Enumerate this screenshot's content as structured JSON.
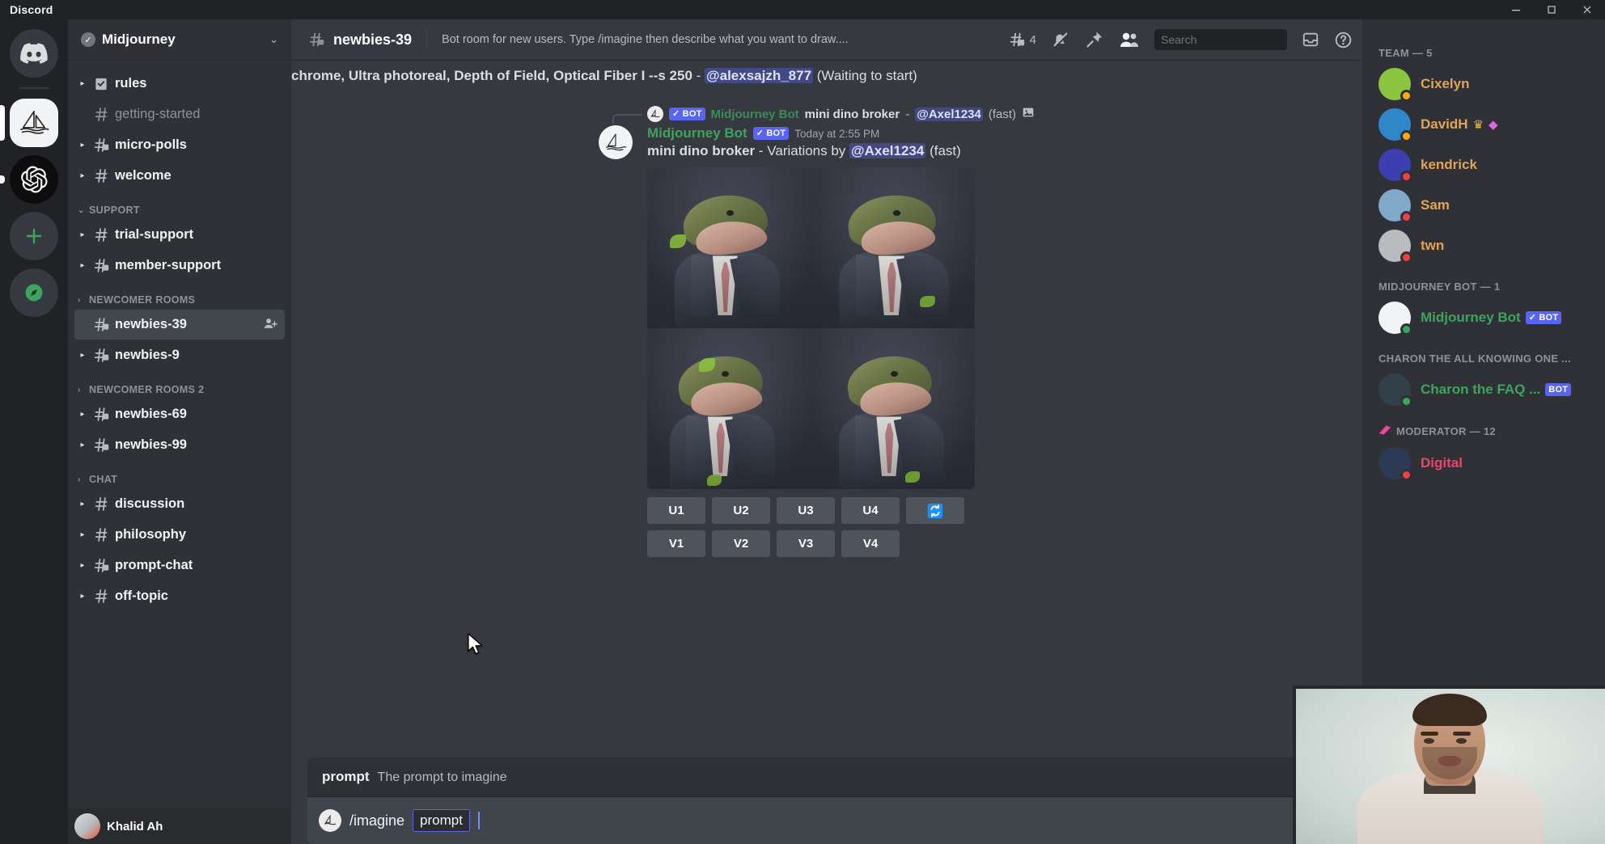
{
  "titlebar": {
    "brand": "Discord",
    "minimize": "—",
    "maximize": "▣",
    "close": "✕"
  },
  "rail": {
    "items": [
      {
        "name": "home",
        "icon": "discord-logo"
      },
      {
        "name": "midjourney",
        "icon": "sailboat"
      },
      {
        "name": "openai",
        "icon": "openai-flower"
      },
      {
        "name": "add-server",
        "icon": "plus"
      },
      {
        "name": "explore",
        "icon": "compass"
      }
    ]
  },
  "sidebar": {
    "server": {
      "name": "Midjourney",
      "verified": "✓",
      "chevron": "⌄"
    },
    "groups": [
      {
        "label": "",
        "arrow": "",
        "channels": [
          {
            "name": "rules",
            "icon": "rules",
            "arrow": "▸",
            "bright": true
          },
          {
            "name": "getting-started",
            "icon": "hash",
            "arrow": "",
            "bright": false
          },
          {
            "name": "micro-polls",
            "icon": "forum",
            "arrow": "▸",
            "bright": true
          },
          {
            "name": "welcome",
            "icon": "hash",
            "arrow": "▸",
            "bright": true
          }
        ]
      },
      {
        "label": "SUPPORT",
        "arrow": "⌄",
        "channels": [
          {
            "name": "trial-support",
            "icon": "hash",
            "arrow": "▸",
            "bright": true
          },
          {
            "name": "member-support",
            "icon": "forum",
            "arrow": "▸",
            "bright": true
          }
        ]
      },
      {
        "label": "NEWCOMER ROOMS",
        "arrow": "›",
        "channels": [
          {
            "name": "newbies-39",
            "icon": "forum",
            "arrow": "",
            "bright": true,
            "selected": true,
            "invite": "person-add"
          },
          {
            "name": "newbies-9",
            "icon": "forum",
            "arrow": "▸",
            "bright": true
          }
        ]
      },
      {
        "label": "NEWCOMER ROOMS 2",
        "arrow": "›",
        "channels": [
          {
            "name": "newbies-69",
            "icon": "forum",
            "arrow": "▸",
            "bright": true
          },
          {
            "name": "newbies-99",
            "icon": "forum",
            "arrow": "▸",
            "bright": true
          }
        ]
      },
      {
        "label": "CHAT",
        "arrow": "›",
        "channels": [
          {
            "name": "discussion",
            "icon": "hash",
            "arrow": "▸",
            "bright": true
          },
          {
            "name": "philosophy",
            "icon": "hash",
            "arrow": "▸",
            "bright": true
          },
          {
            "name": "prompt-chat",
            "icon": "forum",
            "arrow": "▸",
            "bright": true
          },
          {
            "name": "off-topic",
            "icon": "hash",
            "arrow": "▸",
            "bright": true
          }
        ]
      }
    ],
    "user": {
      "name": "Khalid Ah"
    }
  },
  "channel_header": {
    "hash": "#",
    "title": "newbies-39",
    "topic": "Bot room for new users. Type /imagine then describe what you want to draw....",
    "threads_count": "4",
    "tools": [
      "threads-icon",
      "notification-off-icon",
      "pin-icon",
      "members-icon"
    ],
    "search_placeholder": "Search",
    "search_value": "",
    "inbox_icon": "inbox",
    "help_icon": "?"
  },
  "messages": {
    "previous_tail": {
      "text_a": "chrome, Ultra photoreal, Depth of Field, Optical Fiber I --s 250",
      "dash": " - ",
      "mention": "@alexsajzh_877",
      "text_b": " (Waiting to start)"
    },
    "reply_context": {
      "bot_tag": "✓ BOT",
      "author": "Midjourney Bot",
      "prompt": "mini dino broker",
      "dash": " - ",
      "mention": "@Axel1234",
      "suffix": " (fast)",
      "attach_icon": "image-icon"
    },
    "main": {
      "author": "Midjourney Bot",
      "bot_tag": "✓ BOT",
      "timestamp": "Today at 2:55 PM",
      "prompt": "mini dino broker",
      "separator": " - ",
      "action": "Variations by ",
      "mention": "@Axel1234",
      "suffix": " (fast)"
    },
    "buttons": {
      "upscale": [
        "U1",
        "U2",
        "U3",
        "U4"
      ],
      "refresh": "🔄",
      "variation": [
        "V1",
        "V2",
        "V3",
        "V4"
      ]
    }
  },
  "autocomplete": {
    "key": "prompt",
    "description": "The prompt to imagine"
  },
  "composer": {
    "command": "/imagine",
    "chip": "prompt",
    "emoji_icon": "emoji-smile"
  },
  "members": {
    "sections": [
      {
        "label": "TEAM — 5",
        "icon": "",
        "people": [
          {
            "name": "Cixelyn",
            "color": "#e0a458",
            "status": "idle",
            "avatar": "#8bc53f",
            "badges": []
          },
          {
            "name": "DavidH",
            "color": "#e0a458",
            "status": "idle",
            "avatar": "#2f86c8",
            "badges": [
              "crown",
              "gem"
            ]
          },
          {
            "name": "kendrick",
            "color": "#e0a458",
            "status": "dnd",
            "avatar": "#3b3fb0",
            "badges": []
          },
          {
            "name": "Sam",
            "color": "#e0a458",
            "status": "dnd",
            "avatar": "#7fa8c9",
            "badges": []
          },
          {
            "name": "twn",
            "color": "#e0a458",
            "status": "dnd",
            "avatar": "#b9bbbe",
            "badges": []
          }
        ]
      },
      {
        "label": "MIDJOURNEY BOT — 1",
        "icon": "",
        "people": [
          {
            "name": "Midjourney Bot",
            "color": "#3ba55d",
            "status": "online",
            "avatar": "#f2f3f5",
            "bot_tag": "✓ BOT",
            "badges": []
          }
        ]
      },
      {
        "label": "CHARON THE ALL KNOWING ONE ...",
        "icon": "",
        "people": [
          {
            "name": "Charon the FAQ ...",
            "color": "#3ba55d",
            "status": "online",
            "avatar": "#32404a",
            "bot_tag": "BOT",
            "badges": []
          }
        ]
      },
      {
        "label": "MODERATOR — 12",
        "icon": "moderator-icon",
        "people": [
          {
            "name": "Digital",
            "color": "#f2426c",
            "status": "dnd",
            "avatar": "#2b3a55",
            "badges": []
          }
        ]
      }
    ]
  },
  "webcam": {
    "label": "webcam-overlay"
  }
}
